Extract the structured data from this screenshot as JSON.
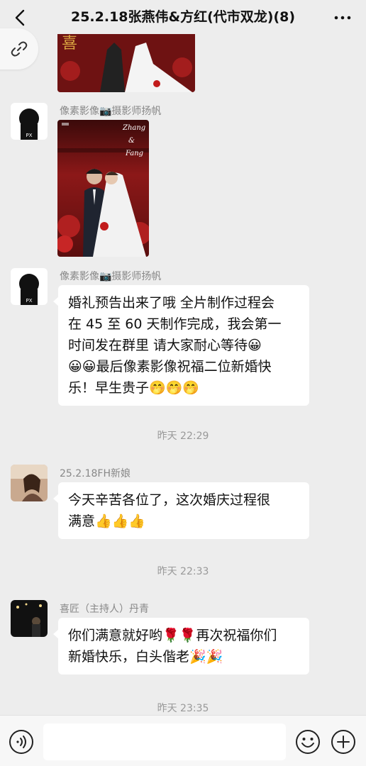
{
  "header": {
    "title": "25.2.18张燕伟&方红(代市双龙)(8)",
    "back_icon": "chevron-left-icon",
    "more_icon": "ellipsis-icon",
    "link_icon": "link-icon"
  },
  "messages": [
    {
      "sender": "像素影像📷摄影师扬帆",
      "type": "image",
      "image_overlay": [
        "Zhang",
        "&",
        "Fang"
      ],
      "avatar_text": "PX"
    },
    {
      "sender": "像素影像📷摄影师扬帆",
      "type": "text",
      "lines": [
        "婚礼预告出来了哦 全片制作过程会",
        "在 45 至 60 天制作完成，我会第一",
        "时间发在群里 请大家耐心等待😀",
        "😀😀最后像素影像祝福二位新婚快",
        "乐！早生贵子🤭🤭🤭"
      ],
      "avatar_text": "PX"
    },
    {
      "timestamp": "昨天 22:29"
    },
    {
      "sender": "25.2.18FH新娘",
      "type": "text",
      "lines": [
        "今天辛苦各位了，这次婚庆过程很",
        "满意👍👍👍"
      ]
    },
    {
      "timestamp": "昨天 22:33"
    },
    {
      "sender": "喜匠（主持人）丹青",
      "type": "text",
      "lines": [
        "你们满意就好哟🌹🌹再次祝福你们",
        "新婚快乐，白头偕老🎉🎉"
      ]
    },
    {
      "timestamp": "昨天 23:35"
    }
  ],
  "input_bar": {
    "placeholder": "",
    "voice_icon": "voice-icon",
    "emoji_icon": "smiley-icon",
    "plus_icon": "plus-circle-icon"
  },
  "colors": {
    "background": "#ededed",
    "bubble": "#ffffff",
    "photo_red": "#8b1a1a"
  }
}
